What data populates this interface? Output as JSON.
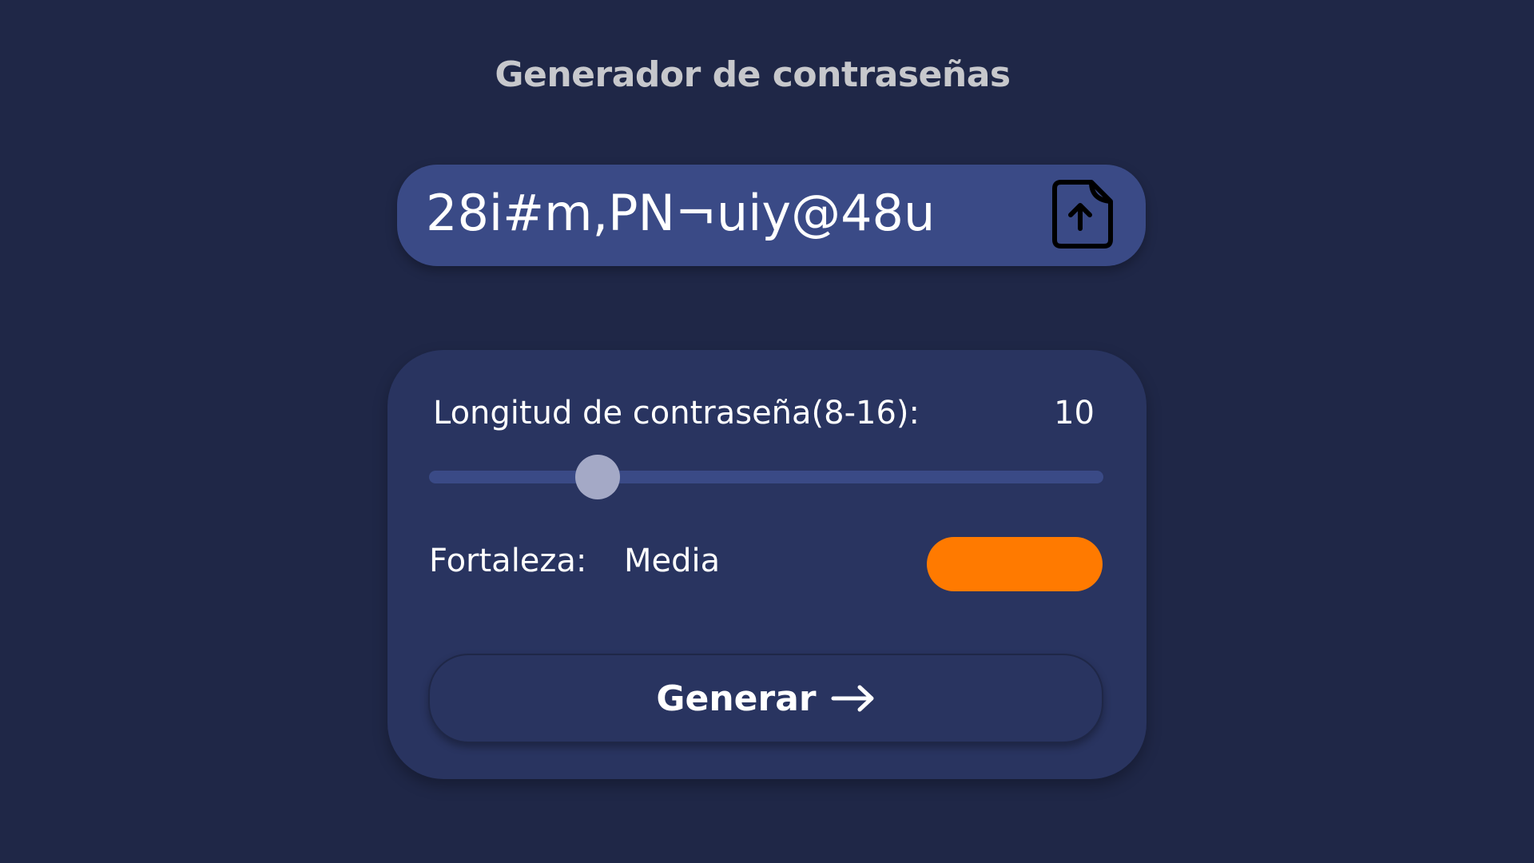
{
  "app": {
    "title": "Generador de contraseñas"
  },
  "password": {
    "value": "28i#m,PN¬uiy@48u",
    "copy_icon": "file-upload-icon"
  },
  "settings": {
    "length_label": "Longitud de contraseña(8-16):",
    "length_value": "10",
    "length_min": 8,
    "length_max": 16,
    "length_current": 10,
    "strength_label": "Fortaleza:",
    "strength_value": "Media",
    "strength_color": "#ff7a00"
  },
  "actions": {
    "generate_label": "Generar",
    "generate_icon": "arrow-right-icon"
  },
  "colors": {
    "background": "#1f2747",
    "card": "#293460",
    "accent_blue": "#3a4a86",
    "slider_thumb": "#a4a9c6"
  }
}
